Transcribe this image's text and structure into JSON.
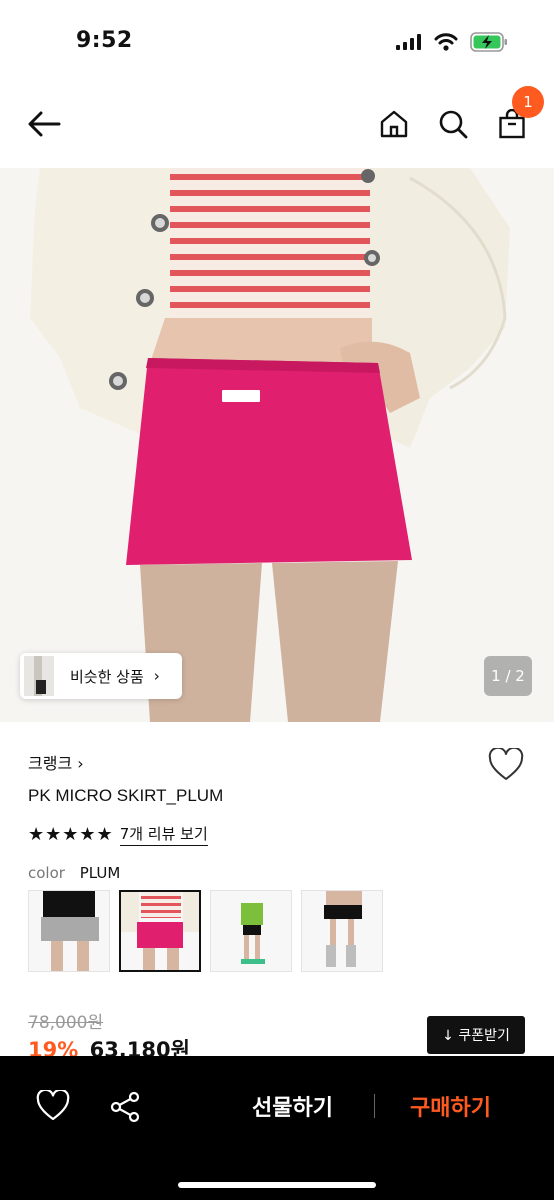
{
  "status_bar": {
    "time": "9:52"
  },
  "nav": {
    "cart_count": "1"
  },
  "hero": {
    "similar_label": "비슷한 상품",
    "chevron": "›",
    "page_indicator": "1 / 2"
  },
  "product": {
    "brand": "크랭크 ›",
    "name": "PK MICRO SKIRT_PLUM",
    "stars": "★★★★★",
    "review_link": "7개 리뷰 보기",
    "color_label": "color",
    "color_value": "PLUM",
    "original_price": "78,000원",
    "discount": "19%",
    "price": "63,180원",
    "coupon_label": "↓ 쿠폰받기"
  },
  "bottom_bar": {
    "gift_label": "선물하기",
    "buy_label": "구매하기"
  },
  "colors": {
    "accent": "#ff5a1f",
    "skirt": "#e0206e",
    "bottom_bar": "#000000"
  },
  "icons": [
    "back-arrow-icon",
    "home-icon",
    "search-icon",
    "cart-icon",
    "heart-icon",
    "share-icon",
    "signal-icon",
    "wifi-icon",
    "battery-icon"
  ]
}
